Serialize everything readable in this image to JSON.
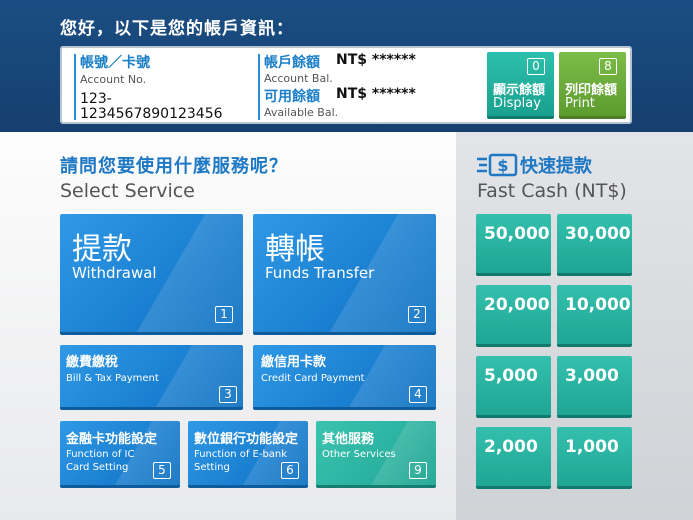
{
  "header": {
    "greeting": "您好，以下是您的帳戶資訊：",
    "account": {
      "label_zh": "帳號／卡號",
      "label_en": "Account No.",
      "value_line1": "123-",
      "value_line2": "1234567890123456"
    },
    "account_balance": {
      "label_zh": "帳戶餘額",
      "label_en": "Account Bal.",
      "value": "NT$ ******"
    },
    "available_balance": {
      "label_zh": "可用餘額",
      "label_en": "Available Bal.",
      "value": "NT$ ******"
    },
    "display_button": {
      "number": "0",
      "label_zh": "顯示餘額",
      "label_en": "Display",
      "color": "#1fae9c"
    },
    "print_button": {
      "number": "8",
      "label_zh": "列印餘額",
      "label_en": "Print",
      "color": "#6fae3d"
    }
  },
  "services": {
    "title_zh": "請問您要使用什麼服務呢？",
    "title_en": "Select Service",
    "items": [
      {
        "zh": "提款",
        "en": "Withdrawal",
        "number": "1"
      },
      {
        "zh": "轉帳",
        "en": "Funds Transfer",
        "number": "2"
      },
      {
        "zh": "繳費繳稅",
        "en": "Bill & Tax Payment",
        "number": "3"
      },
      {
        "zh": "繳信用卡款",
        "en": "Credit Card Payment",
        "number": "4"
      },
      {
        "zh": "金融卡功能設定",
        "en_line1": "Function of IC",
        "en_line2": "Card Setting",
        "number": "5"
      },
      {
        "zh": "數位銀行功能設定",
        "en_line1": "Function of E-bank",
        "en_line2": "Setting",
        "number": "6"
      },
      {
        "zh": "其他服務",
        "en": "Other Services",
        "number": "9"
      }
    ]
  },
  "fast_cash": {
    "title_zh": "快速提款",
    "title_en": "Fast Cash (NT$)",
    "icon": "cash-icon",
    "amounts": [
      "50,000",
      "30,000",
      "20,000",
      "10,000",
      "5,000",
      "3,000",
      "2,000",
      "1,000"
    ]
  },
  "colors": {
    "header_bg": "#1b4e83",
    "accent_blue": "#1f78c4",
    "tile_blue": "#1a7fd0",
    "tile_teal": "#20a594"
  }
}
